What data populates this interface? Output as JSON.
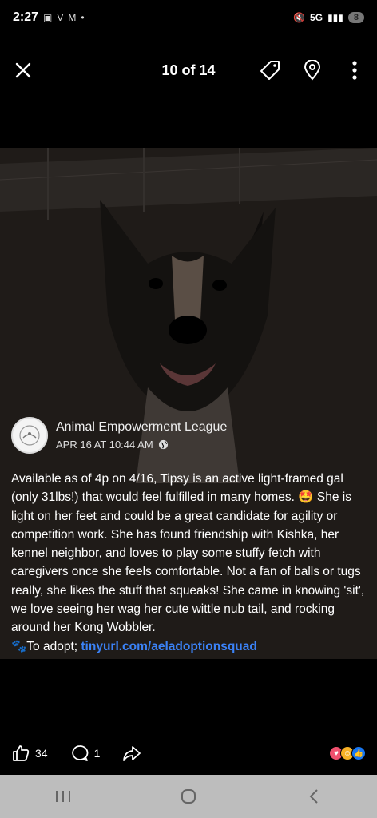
{
  "status": {
    "time": "2:27",
    "icons_left": [
      "instagram-mini",
      "V",
      "M",
      "•"
    ],
    "network": "5G",
    "battery": "8"
  },
  "viewer": {
    "counter": "10 of 14"
  },
  "post": {
    "author": "Animal Empowerment League",
    "date": "APR 16 AT 10:44 AM",
    "body": "Available as of 4p on 4/16, Tipsy is an active light-framed gal (only 31lbs!) that would feel fulfilled in many homes. 🤩 She is light on her feet and could be a great candidate for agility or competition work. She has found friendship with Kishka, her kennel neighbor, and loves to play some stuffy fetch with caregivers once she feels comfortable. Not a fan of balls or tugs really, she likes the stuff that squeaks! She came in knowing 'sit', we love seeing her wag her cute wittle nub tail, and rocking around her Kong Wobbler.",
    "adopt_prefix": "🐾To adopt; ",
    "adopt_link": "tinyurl.com/aeladoptionsquad"
  },
  "actions": {
    "likes": "34",
    "comments": "1"
  },
  "colors": {
    "link": "#3b82f6",
    "nav_bg": "#bdbdbd",
    "background": "#000000"
  }
}
